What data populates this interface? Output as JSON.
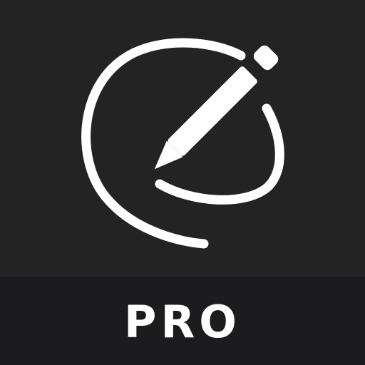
{
  "icon": {
    "name": "edit-pencil-icon",
    "label": "PRO",
    "colors": {
      "background": "#232324",
      "banner": "#1c1c1e",
      "foreground": "#ffffff"
    }
  }
}
